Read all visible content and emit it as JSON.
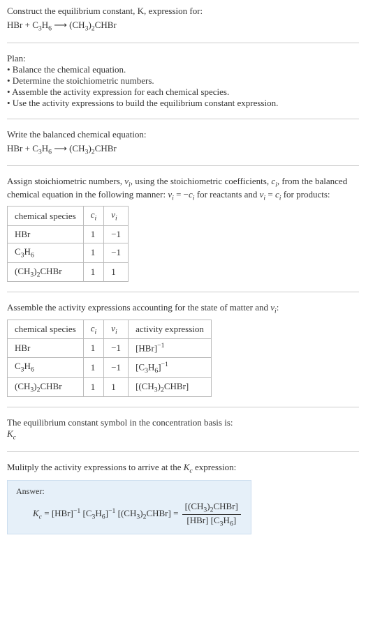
{
  "intro": {
    "line1": "Construct the equilibrium constant, K, expression for:",
    "eqn_lhs1": "HBr + C",
    "eqn_lhs2": "3",
    "eqn_lhs3": "H",
    "eqn_lhs4": "6",
    "arrow": " ⟶ ",
    "eqn_rhs1": "(CH",
    "eqn_rhs2": "3",
    "eqn_rhs3": ")",
    "eqn_rhs4": "2",
    "eqn_rhs5": "CHBr"
  },
  "plan": {
    "heading": "Plan:",
    "b1": "• Balance the chemical equation.",
    "b2": "• Determine the stoichiometric numbers.",
    "b3": "• Assemble the activity expression for each chemical species.",
    "b4": "• Use the activity expressions to build the equilibrium constant expression."
  },
  "balanced": {
    "heading": "Write the balanced chemical equation:"
  },
  "stoich": {
    "intro1": "Assign stoichiometric numbers, ",
    "sym_nu": "ν",
    "sym_i": "i",
    "intro2": ", using the stoichiometric coefficients, ",
    "sym_c": "c",
    "intro3": ", from the balanced chemical equation in the following manner: ",
    "rel1a": "ν",
    "rel1b": " = −",
    "rel1c": "c",
    "rel1d": " for reactants and ",
    "rel2a": "ν",
    "rel2b": " = ",
    "rel2c": "c",
    "rel2d": " for products:",
    "headers": {
      "h1": "chemical species",
      "h2": "c",
      "h3": "ν"
    },
    "rows": [
      {
        "species_a": "HBr",
        "c": "1",
        "nu": "−1"
      },
      {
        "species_a": "C",
        "species_b": "3",
        "species_c": "H",
        "species_d": "6",
        "c": "1",
        "nu": "−1"
      },
      {
        "species_a": "(CH",
        "species_b": "3",
        "species_c": ")",
        "species_d": "2",
        "species_e": "CHBr",
        "c": "1",
        "nu": "1"
      }
    ]
  },
  "activity": {
    "heading_a": "Assemble the activity expressions accounting for the state of matter and ",
    "heading_b": ":",
    "headers": {
      "h1": "chemical species",
      "h2": "c",
      "h3": "ν",
      "h4": "activity expression"
    },
    "rows": [
      {
        "c": "1",
        "nu": "−1",
        "expr_a": "[HBr]",
        "expr_b": "−1"
      },
      {
        "c": "1",
        "nu": "−1",
        "expr_a": "[C",
        "expr_b": "3",
        "expr_c": "H",
        "expr_d": "6",
        "expr_e": "]",
        "expr_f": "−1"
      },
      {
        "c": "1",
        "nu": "1",
        "expr_a": "[(CH",
        "expr_b": "3",
        "expr_c": ")",
        "expr_d": "2",
        "expr_e": "CHBr]"
      }
    ]
  },
  "conc": {
    "line1": "The equilibrium constant symbol in the concentration basis is:",
    "Ksym": "K",
    "csub": "c"
  },
  "final": {
    "line1_a": "Mulitply the activity expressions to arrive at the ",
    "line1_b": " expression:",
    "answer_label": "Answer:",
    "eq_a": "K",
    "eq_b": "c",
    "eq_c": " = [HBr]",
    "eq_d": "−1",
    "eq_e": " [C",
    "eq_f": "3",
    "eq_g": "H",
    "eq_h": "6",
    "eq_i": "]",
    "eq_j": "−1",
    "eq_k": " [(CH",
    "eq_l": "3",
    "eq_m": ")",
    "eq_n": "2",
    "eq_o": "CHBr] = ",
    "num_a": "[(CH",
    "num_b": "3",
    "num_c": ")",
    "num_d": "2",
    "num_e": "CHBr]",
    "den_a": "[HBr] [C",
    "den_b": "3",
    "den_c": "H",
    "den_d": "6",
    "den_e": "]"
  }
}
